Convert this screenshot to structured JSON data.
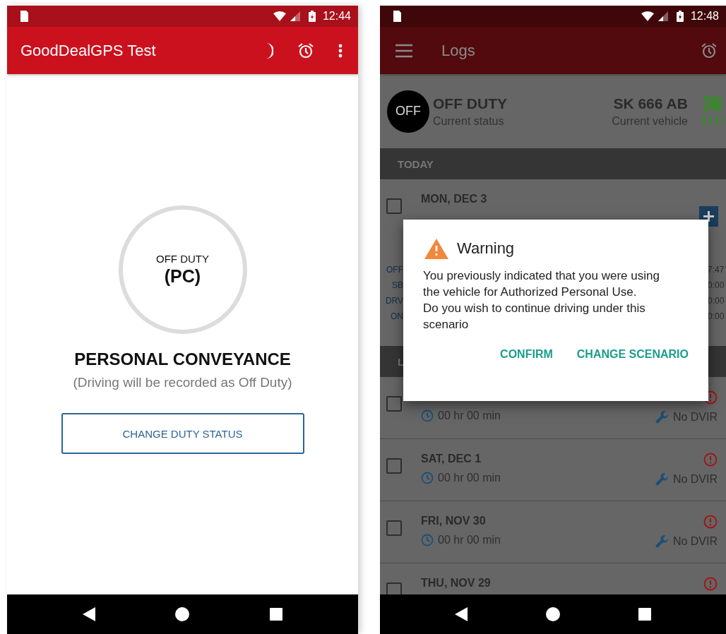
{
  "left_screen": {
    "status_bar": {
      "time": "12:44"
    },
    "toolbar": {
      "title": "GoodDealGPS Test"
    },
    "status_circle": {
      "label": "OFF DUTY",
      "code": "(PC)"
    },
    "heading": "PERSONAL CONVEYANCE",
    "subtitle": "(Driving will be recorded as Off Duty)",
    "button": "CHANGE DUTY STATUS"
  },
  "right_screen": {
    "status_bar": {
      "time": "12:48"
    },
    "toolbar": {
      "title": "Logs"
    },
    "current": {
      "badge": "OFF",
      "status": "OFF DUTY",
      "status_caption": "Current status",
      "vehicle": "SK 666 AB",
      "vehicle_caption": "Current vehicle",
      "eld_label": "ELD"
    },
    "sections": [
      {
        "title": "TODAY",
        "logs": [
          {
            "date": "MON, DEC 3",
            "checked": false,
            "duty_labels": [
              "OFF",
              "SB",
              "DRV",
              "ON"
            ],
            "duty_values": [
              "7:47",
              "0:00",
              "0:00",
              "0:00"
            ]
          }
        ]
      },
      {
        "title": "L",
        "logs": [
          {
            "checked": false,
            "duration": "00 hr  00 min",
            "dvir": "No DVIR"
          },
          {
            "date": "SAT, DEC 1",
            "checked": false,
            "duration": "00 hr  00 min",
            "dvir": "No DVIR"
          },
          {
            "date": "FRI, NOV 30",
            "checked": false,
            "duration": "00 hr  00 min",
            "dvir": "No DVIR"
          },
          {
            "date": "THU, NOV 29",
            "checked": false
          }
        ]
      }
    ],
    "dialog": {
      "title": "Warning",
      "message": "You previously indicated that you were using the vehicle for Authorized Personal Use.\nDo you wish to continue driving under this scenario",
      "buttons": [
        "CONFIRM",
        "CHANGE SCENARIO"
      ]
    }
  }
}
